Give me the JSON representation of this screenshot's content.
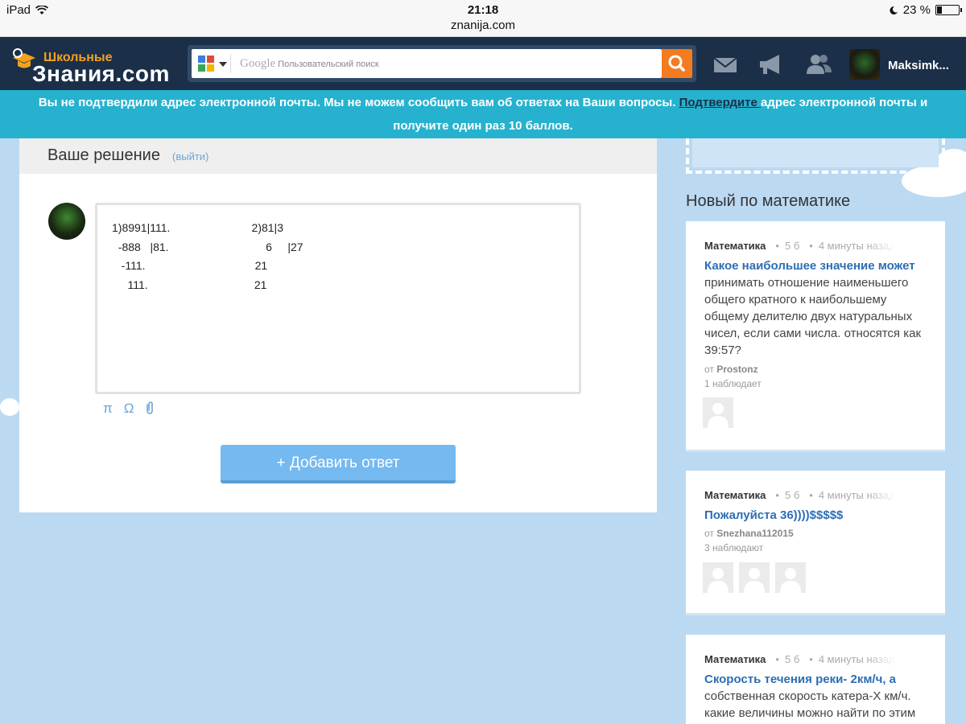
{
  "status_bar": {
    "device": "iPad",
    "time": "21:18",
    "url": "znanija.com",
    "battery": "23 %",
    "battery_level": 0.23
  },
  "header": {
    "logo_small": "Школьные",
    "logo_big": "Знания.com",
    "search_brand": "Google",
    "search_placeholder": "Пользовательский поиск",
    "username": "Maksimk..."
  },
  "notice": {
    "text_before": "Вы не подтвердили адрес электронной почты. Мы не можем сообщить вам об ответах на Ваши вопросы. ",
    "link": "Подтвердите ",
    "text_after": "адрес электронной почты и получите один раз 10 баллов."
  },
  "answer": {
    "title": "Ваше решение",
    "exit": "(выйти)",
    "editor_text": "1)8991|111.                          2)81|3\n  -888   |81.                               6     |27\n   -111.                                   21\n     111.                                  21",
    "tools": [
      "π",
      "Ω",
      "📎"
    ],
    "add_button": "+ Добавить ответ"
  },
  "sidebar": {
    "title": "Новый по математике",
    "questions": [
      {
        "subject": "Математика",
        "points": "5 б",
        "time": "4 минуты назад",
        "highlight": "Какое наибольшее значение может",
        "rest": " принимать отношение наименьшего общего кратного к наибольшему общему делителю двух натуральных чисел, если сами числа. относятся как 39:57?",
        "by_prefix": "от ",
        "author": "Prostonz",
        "watchers": "1 наблюдает",
        "watcher_count": 1
      },
      {
        "subject": "Математика",
        "points": "5 б",
        "time": "4 минуты назад",
        "highlight": "Пожалуйста 36))))$$$$$",
        "rest": "",
        "by_prefix": "от ",
        "author": "Snezhana112015",
        "watchers": "3 наблюдают",
        "watcher_count": 3
      },
      {
        "subject": "Математика",
        "points": "5 б",
        "time": "4 минуты назад",
        "highlight": "Скорость течения реки- 2км/ч, а",
        "rest": " собственная скорость катера-X км/ч. какие величины можно найти по этим",
        "by_prefix": "",
        "author": "",
        "watchers": "",
        "watcher_count": 0
      }
    ]
  },
  "colors": {
    "header_bg": "#1b2f49",
    "notice_bg": "#26b2cf",
    "accent_orange": "#f47b1f",
    "link_blue": "#2c6eb5",
    "button_blue": "#74b9f0",
    "page_bg": "#bcd9f2"
  }
}
